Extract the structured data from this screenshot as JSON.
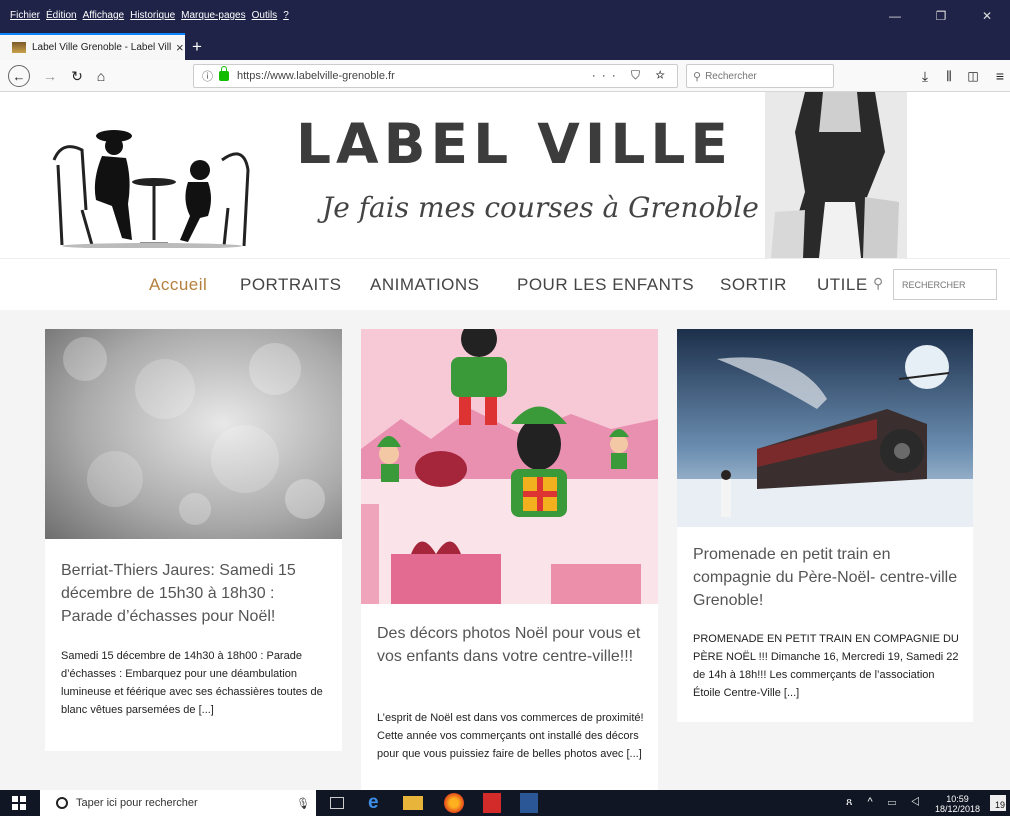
{
  "menubar": {
    "items": [
      "Fichier",
      "Édition",
      "Affichage",
      "Historique",
      "Marque-pages",
      "Outils",
      "?"
    ]
  },
  "tab": {
    "title": "Label Ville Grenoble - Label Vill",
    "close": "×",
    "new": "+"
  },
  "navbar": {
    "url": "https://www.labelville-grenoble.fr",
    "search_placeholder": "Rechercher",
    "url_actions": "··· ⛉ ☆"
  },
  "header": {
    "title": "LABEL VILLE",
    "subtitle": "Je fais mes courses à Grenoble"
  },
  "nav": {
    "items": [
      "Accueil",
      "PORTRAITS",
      "ANIMATIONS",
      "POUR LES ENFANTS",
      "SORTIR",
      "UTILE"
    ],
    "search_placeholder": "RECHERCHER"
  },
  "cards": [
    {
      "title": "Berriat-Thiers Jaures: Samedi 15 décembre de 15h30 à 18h30 : Parade d’échasses pour Noël!",
      "excerpt": "Samedi 15 décembre de 14h30 à 18h00 : Parade d’échasses : Embarquez pour une déambulation lumineuse et féérique avec ses échassières toutes de blanc vêtues parsemées de [...]"
    },
    {
      "title": "Des décors photos Noël pour vous et vos enfants dans votre centre-ville!!!",
      "excerpt": "L’esprit de Noël est dans vos commerces de proximité! Cette année vos commerçants ont installé des décors pour que vous puissiez faire de belles photos avec [...]"
    },
    {
      "title": "Promenade en petit train en compagnie du Père-Noël- centre-ville Grenoble!",
      "excerpt": "PROMENADE EN PETIT TRAIN EN COMPAGNIE DU PÈRE NOËL !!! Dimanche 16, Mercredi 19, Samedi 22 de 14h à 18h!!! Les commerçants de l’association Étoile Centre-Ville [...]"
    }
  ],
  "taskbar": {
    "search_placeholder": "Taper ici pour rechercher",
    "time": "10:59",
    "date": "18/12/2018",
    "notif": "19"
  }
}
